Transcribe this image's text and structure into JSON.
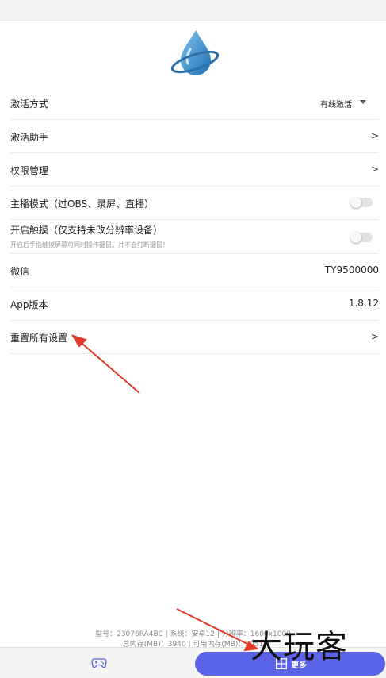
{
  "settings": {
    "activation_mode": {
      "label": "激活方式",
      "value": "有线激活"
    },
    "activation_helper": {
      "label": "激活助手",
      "arrow": ">"
    },
    "permission_management": {
      "label": "权限管理",
      "arrow": ">"
    },
    "streamer_mode": {
      "label": "主播模式（过OBS、录屏、直播）",
      "enabled": false
    },
    "enable_touch": {
      "label": "开启触摸（仅支持未改分辨率设备）",
      "sublabel": "开启后手指触摸屏幕可同时操作键鼠，并不会打断键鼠！",
      "enabled": false
    },
    "wechat": {
      "label": "微信",
      "value": "TY9500000"
    },
    "app_version": {
      "label": "App版本",
      "value": "1.8.12"
    },
    "reset_all": {
      "label": "重置所有设置",
      "arrow": ">"
    }
  },
  "footer": {
    "line1": "型号：23076RA4BC | 系统：安卓12 | 分辨率：1600x1000",
    "line2": "总内存(MB)：3940 | 可用内存(MB)：2051"
  },
  "bottom_nav": {
    "game_icon": "gamepad-icon",
    "more_icon": "grid-icon",
    "more_label": "更多"
  },
  "watermark": "大玩客",
  "colors": {
    "accent": "#5b63e8",
    "annotation": "#e53a2a",
    "logo_blue": "#3d8fd0"
  }
}
